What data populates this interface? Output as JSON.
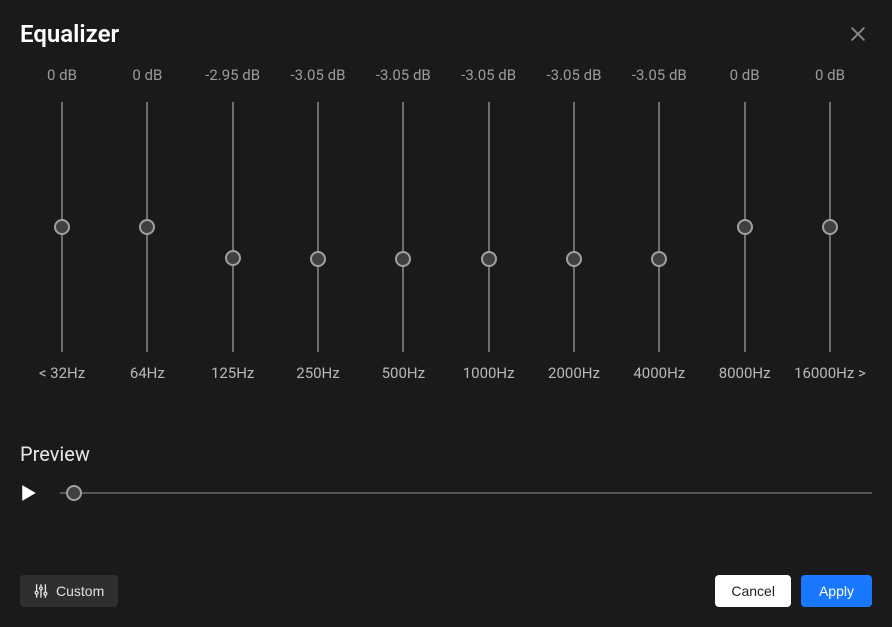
{
  "header": {
    "title": "Equalizer"
  },
  "eq": {
    "min_db": -12,
    "max_db": 12,
    "bands": [
      {
        "db_label": "0 dB",
        "db": 0,
        "freq_label": "< 32Hz"
      },
      {
        "db_label": "0 dB",
        "db": 0,
        "freq_label": "64Hz"
      },
      {
        "db_label": "-2.95 dB",
        "db": -2.95,
        "freq_label": "125Hz"
      },
      {
        "db_label": "-3.05 dB",
        "db": -3.05,
        "freq_label": "250Hz"
      },
      {
        "db_label": "-3.05 dB",
        "db": -3.05,
        "freq_label": "500Hz"
      },
      {
        "db_label": "-3.05 dB",
        "db": -3.05,
        "freq_label": "1000Hz"
      },
      {
        "db_label": "-3.05 dB",
        "db": -3.05,
        "freq_label": "2000Hz"
      },
      {
        "db_label": "-3.05 dB",
        "db": -3.05,
        "freq_label": "4000Hz"
      },
      {
        "db_label": "0 dB",
        "db": 0,
        "freq_label": "8000Hz"
      },
      {
        "db_label": "0 dB",
        "db": 0,
        "freq_label": "16000Hz >"
      }
    ]
  },
  "preview": {
    "title": "Preview",
    "position": 0
  },
  "footer": {
    "preset_label": "Custom",
    "cancel_label": "Cancel",
    "apply_label": "Apply"
  }
}
